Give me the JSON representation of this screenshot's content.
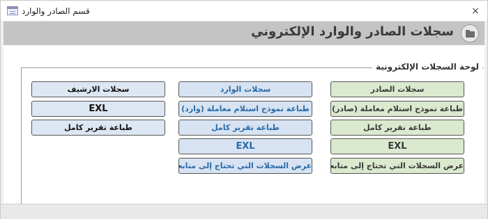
{
  "window": {
    "title": "قسم الصادر والوارد",
    "close_glyph": "×"
  },
  "header": {
    "title": "سجلات الصادر والوارد الإلكتروني"
  },
  "panel": {
    "legend": "لوحة السجلات الإلكترونية"
  },
  "columns": {
    "outgoing": [
      "سجلات الصادر",
      "طباعة نموذج استلام معاملة (صادر)",
      "طباعة تقرير كامل",
      "EXL",
      "عرض السجلات التي تحتاج إلى متابعة"
    ],
    "incoming": [
      "سجلات الوارد",
      "طباعة نموذج استلام معاملة (وارد)",
      "طباعة تقرير كامل",
      "EXL",
      "عرض السجلات التي تحتاج إلى متابعة"
    ],
    "archive": [
      "سجلات الارشيف",
      "EXL",
      "طباعة تقرير كامل"
    ]
  },
  "colors": {
    "outgoing_bg": "#dbe9cf",
    "incoming_bg": "#d7e3f2",
    "incoming_text": "#2a6aa6",
    "archive_bg": "#dde7f3",
    "header_bg": "#c4c4c4"
  },
  "icons": [
    "form-icon",
    "close-icon",
    "folder-icon"
  ]
}
